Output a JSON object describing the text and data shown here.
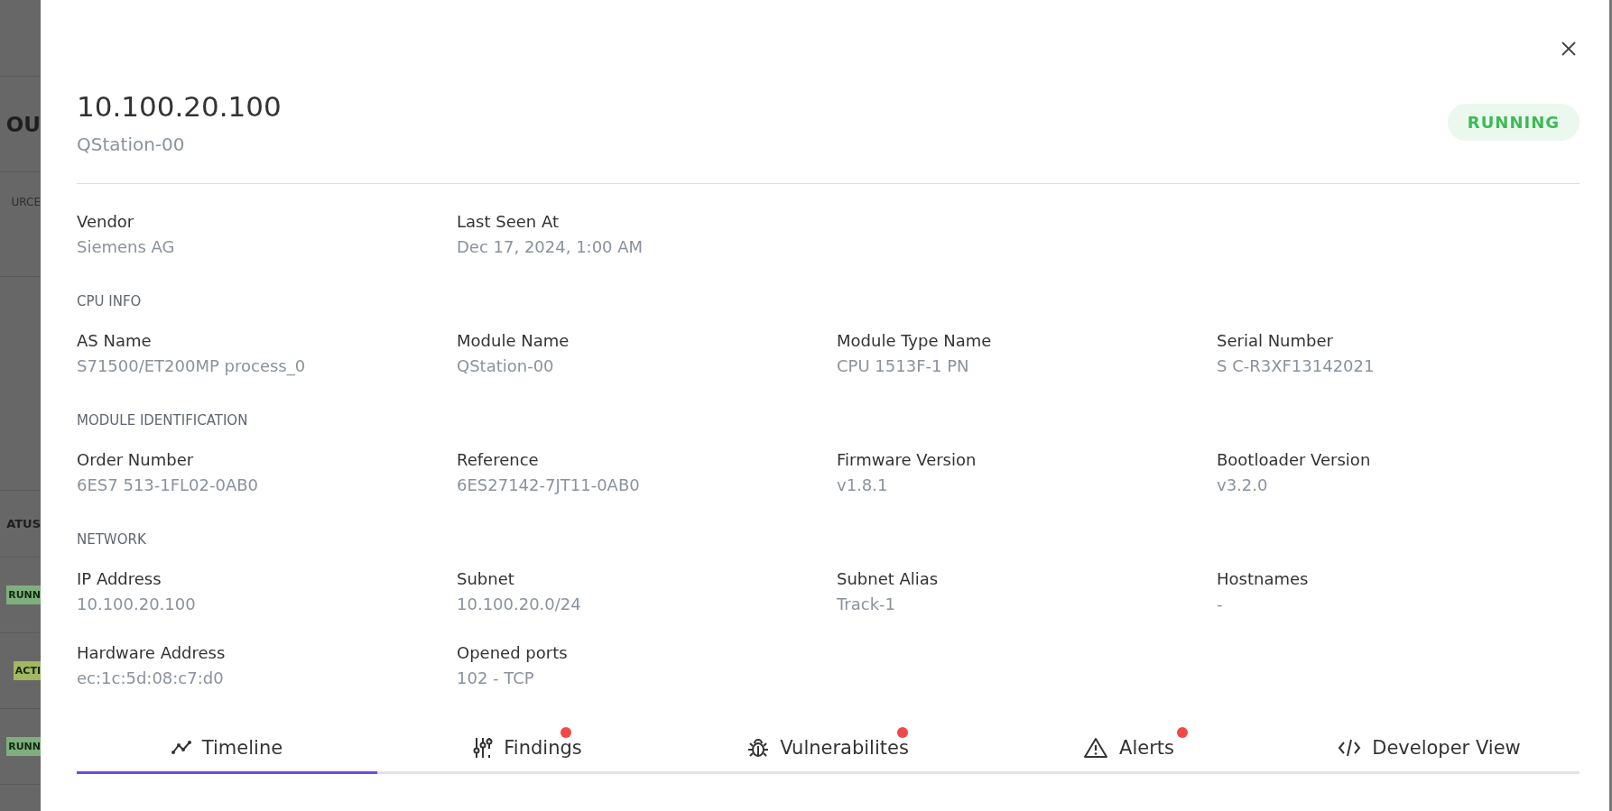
{
  "background_page": {
    "texts": [
      {
        "kind": "heading",
        "text": "OU"
      },
      {
        "kind": "label",
        "text": "URCE"
      },
      {
        "kind": "spacer"
      },
      {
        "kind": "column",
        "text": "ATUS"
      },
      {
        "kind": "status",
        "text": "RUNN",
        "color": "#7fae7f"
      },
      {
        "kind": "status",
        "text": "ACTI",
        "color": "#a3b860"
      },
      {
        "kind": "status",
        "text": "RUNN",
        "color": "#7fae7f"
      }
    ]
  },
  "drawer": {
    "title": "10.100.20.100",
    "subtitle": "QStation-00",
    "status": "RUNNING",
    "sections": [
      {
        "fields": [
          {
            "label": "Vendor",
            "value": "Siemens AG"
          },
          {
            "label": "Last Seen At",
            "value": "Dec 17, 2024, 1:00 AM"
          }
        ]
      },
      {
        "heading": "CPU INFO",
        "fields": [
          {
            "label": "AS Name",
            "value": "S71500/ET200MP process_0"
          },
          {
            "label": "Module Name",
            "value": "QStation-00"
          },
          {
            "label": "Module Type Name",
            "value": "CPU 1513F-1 PN"
          },
          {
            "label": "Serial Number",
            "value": "S C-R3XF13142021"
          }
        ]
      },
      {
        "heading": "MODULE IDENTIFICATION",
        "fields": [
          {
            "label": "Order Number",
            "value": "6ES7 513-1FL02-0AB0"
          },
          {
            "label": "Reference",
            "value": "6ES27142-7JT11-0AB0"
          },
          {
            "label": "Firmware Version",
            "value": "v1.8.1"
          },
          {
            "label": "Bootloader Version",
            "value": "v3.2.0"
          }
        ]
      },
      {
        "heading": "NETWORK",
        "fields": [
          {
            "label": "IP Address",
            "value": "10.100.20.100"
          },
          {
            "label": "Subnet",
            "value": "10.100.20.0/24"
          },
          {
            "label": "Subnet Alias",
            "value": "Track-1"
          },
          {
            "label": "Hostnames",
            "value": "-"
          },
          {
            "label": "Hardware Address",
            "value": "ec:1c:5d:08:c7:d0"
          },
          {
            "label": "Opened ports",
            "value": "102 - TCP"
          }
        ]
      }
    ],
    "tabs": [
      {
        "label": "Timeline",
        "selected": true,
        "badge": false
      },
      {
        "label": "Findings",
        "selected": false,
        "badge": true
      },
      {
        "label": "Vulnerabilites",
        "selected": false,
        "badge": true
      },
      {
        "label": "Alerts",
        "selected": false,
        "badge": true
      },
      {
        "label": "Developer View",
        "selected": false,
        "badge": false
      }
    ]
  }
}
